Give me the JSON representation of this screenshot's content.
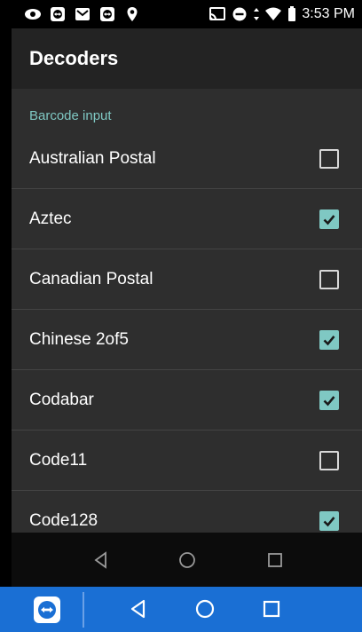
{
  "status_bar": {
    "time": "3:53 PM"
  },
  "app_bar": {
    "title": "Decoders"
  },
  "section": {
    "header": "Barcode input"
  },
  "decoders": [
    {
      "label": "Australian Postal",
      "checked": false
    },
    {
      "label": "Aztec",
      "checked": true
    },
    {
      "label": "Canadian Postal",
      "checked": false
    },
    {
      "label": "Chinese 2of5",
      "checked": true
    },
    {
      "label": "Codabar",
      "checked": true
    },
    {
      "label": "Code11",
      "checked": false
    },
    {
      "label": "Code128",
      "checked": true
    }
  ],
  "colors": {
    "accent": "#7fc8c3",
    "background": "#2e2e2e",
    "app_bar": "#232323",
    "teamviewer_bar": "#1a6fd4"
  }
}
